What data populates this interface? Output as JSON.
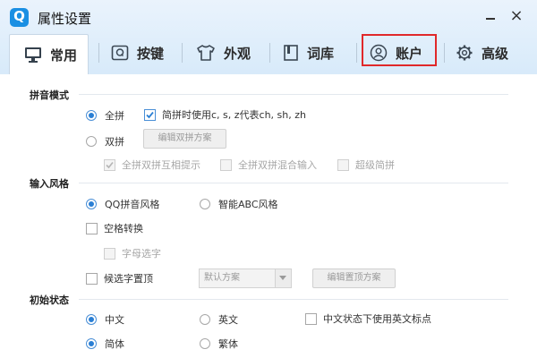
{
  "window": {
    "logo_letter": "Q",
    "title": "属性设置",
    "minimize_label": "",
    "close_label": "×"
  },
  "tabs": [
    {
      "label": "常用",
      "icon": "monitor-icon",
      "active": true
    },
    {
      "label": "按键",
      "icon": "key-q-icon"
    },
    {
      "label": "外观",
      "icon": "tshirt-icon"
    },
    {
      "label": "词库",
      "icon": "book-icon"
    },
    {
      "label": "账户",
      "icon": "user-icon",
      "highlighted": true
    },
    {
      "label": "高级",
      "icon": "gear-icon"
    }
  ],
  "sections": {
    "pinyin_mode": {
      "title": "拼音模式",
      "quanpin": "全拼",
      "jianpin_option": "简拼时使用c, s, z代表ch, sh, zh",
      "shuangpin": "双拼",
      "edit_shuangpin_button": "编辑双拼方案",
      "shuangpin_hint": "全拼双拼互相提示",
      "mixed_input": "全拼双拼混合输入",
      "super_jianpin": "超级简拼"
    },
    "input_style": {
      "title": "输入风格",
      "qq_style": "QQ拼音风格",
      "abc_style": "智能ABC风格",
      "space_convert": "空格转换",
      "letter_select": "字母选字",
      "candidate_top": "候选字置顶",
      "scheme_select_value": "默认方案",
      "edit_top_button": "编辑置顶方案"
    },
    "initial_state": {
      "title": "初始状态",
      "chinese": "中文",
      "english": "英文",
      "english_punct": "中文状态下使用英文标点",
      "simplified": "简体",
      "traditional": "繁体"
    }
  },
  "colors": {
    "accent": "#2a7fd4",
    "highlight_border": "#e0282a",
    "header_bg": "#dfeefb"
  }
}
